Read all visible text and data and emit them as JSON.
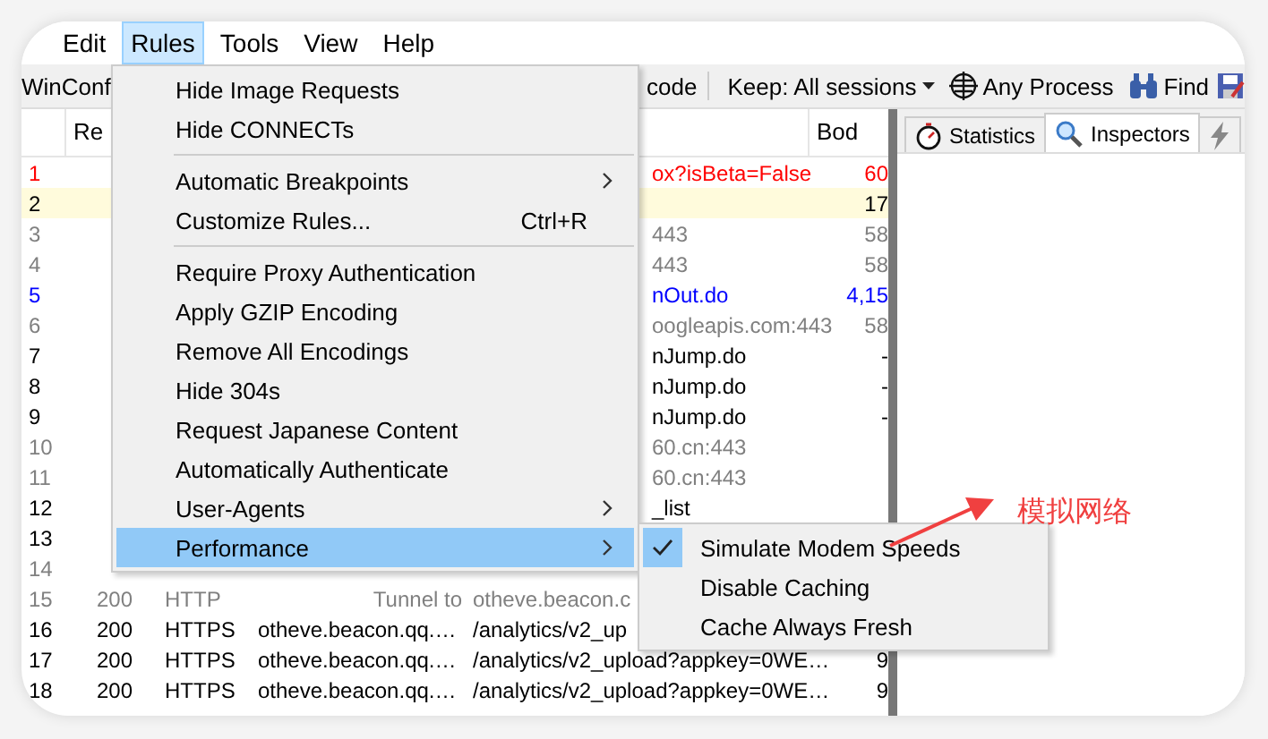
{
  "menu_bar": [
    {
      "label": "Edit",
      "selected": false
    },
    {
      "label": "Rules",
      "selected": true
    },
    {
      "label": "Tools",
      "selected": false
    },
    {
      "label": "View",
      "selected": false
    },
    {
      "label": "Help",
      "selected": false
    }
  ],
  "toolbar": {
    "left_text": "WinConf",
    "decode_text": "code",
    "keep": "Keep: All sessions",
    "process": "Any Process",
    "find": "Find"
  },
  "sessions": {
    "columns": [
      "Re",
      "Bod"
    ],
    "rows": [
      {
        "kind": "partial",
        "num": "1",
        "url": "ox?isBeta=False",
        "body": "60",
        "color": "#ff0000",
        "selected": false
      },
      {
        "kind": "partial",
        "num": "2",
        "url": "",
        "body": "17",
        "color": "#000000",
        "selected": true
      },
      {
        "kind": "partial",
        "num": "3",
        "url": "443",
        "body": "58",
        "color": "#808080",
        "selected": false
      },
      {
        "kind": "partial",
        "num": "4",
        "url": "443",
        "body": "58",
        "color": "#808080",
        "selected": false
      },
      {
        "kind": "partial",
        "num": "5",
        "url": "nOut.do",
        "body": "4,15",
        "color": "#0000ff",
        "selected": false
      },
      {
        "kind": "partial",
        "num": "6",
        "url": "oogleapis.com:443",
        "body": "58",
        "color": "#808080",
        "selected": false
      },
      {
        "kind": "partial",
        "num": "7",
        "url": "nJump.do",
        "body": "-",
        "color": "#000000",
        "selected": false
      },
      {
        "kind": "partial",
        "num": "8",
        "url": "nJump.do",
        "body": "-",
        "color": "#000000",
        "selected": false
      },
      {
        "kind": "partial",
        "num": "9",
        "url": "nJump.do",
        "body": "-",
        "color": "#000000",
        "selected": false
      },
      {
        "kind": "partial",
        "num": "10",
        "url": "60.cn:443",
        "body": "",
        "color": "#808080",
        "selected": false
      },
      {
        "kind": "partial",
        "num": "11",
        "url": "60.cn:443",
        "body": "",
        "color": "#808080",
        "selected": false
      },
      {
        "kind": "partial",
        "num": "12",
        "url": "_list",
        "body": "",
        "color": "#000000",
        "selected": false
      },
      {
        "kind": "partial",
        "num": "13",
        "url": "",
        "body": "",
        "color": "#000000",
        "selected": false
      },
      {
        "kind": "partial",
        "num": "14",
        "url": "",
        "body": "",
        "color": "#808080",
        "selected": false
      },
      {
        "kind": "full",
        "num": "15",
        "result": "200",
        "protocol": "HTTP",
        "host": "Tunnel to",
        "url": "otheve.beacon.c",
        "body": "",
        "color": "#808080",
        "selected": false
      },
      {
        "kind": "full",
        "num": "16",
        "result": "200",
        "protocol": "HTTPS",
        "host": "otheve.beacon.qq.…",
        "url": "/analytics/v2_up",
        "body": "",
        "color": "#000000",
        "selected": false
      },
      {
        "kind": "full",
        "num": "17",
        "result": "200",
        "protocol": "HTTPS",
        "host": "otheve.beacon.qq.…",
        "url": "/analytics/v2_upload?appkey=0WE…",
        "body": "9",
        "color": "#000000",
        "selected": false
      },
      {
        "kind": "full",
        "num": "18",
        "result": "200",
        "protocol": "HTTPS",
        "host": "otheve.beacon.qq.…",
        "url": "/analytics/v2_upload?appkey=0WE…",
        "body": "9",
        "color": "#000000",
        "selected": false
      }
    ]
  },
  "right_tabs": [
    {
      "label": "Statistics",
      "selected": false
    },
    {
      "label": "Inspectors",
      "selected": true
    }
  ],
  "rules_menu": {
    "groups": [
      [
        {
          "label": "Hide Image Requests",
          "submenu": false,
          "selected": false
        },
        {
          "label": "Hide CONNECTs",
          "submenu": false,
          "selected": false
        }
      ],
      [
        {
          "label": "Automatic Breakpoints",
          "submenu": true,
          "selected": false
        },
        {
          "label": "Customize Rules...",
          "shortcut": "Ctrl+R",
          "submenu": false,
          "selected": false
        }
      ],
      [
        {
          "label": "Require Proxy Authentication",
          "submenu": false,
          "selected": false
        },
        {
          "label": "Apply GZIP Encoding",
          "submenu": false,
          "selected": false
        },
        {
          "label": "Remove All Encodings",
          "submenu": false,
          "selected": false
        },
        {
          "label": "Hide 304s",
          "submenu": false,
          "selected": false
        },
        {
          "label": "Request Japanese Content",
          "submenu": false,
          "selected": false
        },
        {
          "label": "Automatically Authenticate",
          "submenu": false,
          "selected": false
        },
        {
          "label": "User-Agents",
          "submenu": true,
          "selected": false
        },
        {
          "label": "Performance",
          "submenu": true,
          "selected": true
        }
      ]
    ]
  },
  "performance_submenu": [
    {
      "label": "Simulate Modem Speeds",
      "checked": true
    },
    {
      "label": "Disable Caching",
      "checked": false
    },
    {
      "label": "Cache Always Fresh",
      "checked": false
    }
  ],
  "annotation": {
    "text": "模拟网络"
  }
}
